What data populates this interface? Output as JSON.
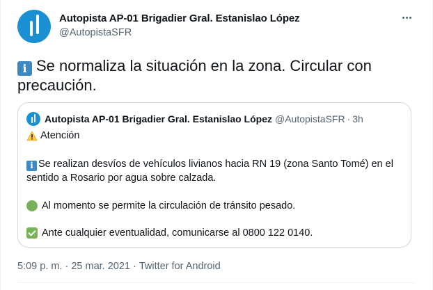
{
  "author": {
    "display_name": "Autopista AP-01 Brigadier Gral. Estanislao López",
    "handle": "@AutopistaSFR"
  },
  "tweet": {
    "info_symbol": "i",
    "text": "Se normaliza la situación en la zona. Circular con precaución."
  },
  "quoted": {
    "display_name": "Autopista AP-01 Brigadier Gral. Estanislao López",
    "handle": "@AutopistaSFR",
    "separator": "·",
    "time": "3h",
    "warning": "Atención",
    "info_symbol": "i",
    "paragraph": "Se realizan desvíos de vehículos livianos hacia RN 19 (zona Santo Tomé) en el sentido a Rosario por agua sobre calzada.",
    "line_green": "Al momento se permite la circulación de tránsito pesado.",
    "line_check": "Ante cualquier eventualidad, comunicarse al 0800 122 0140."
  },
  "meta": {
    "time": "5:09 p. m.",
    "separator": "·",
    "date": "25 mar. 2021",
    "source": "Twitter for Android"
  },
  "colors": {
    "brand": "#1a8fd2",
    "secondary_text": "#536471",
    "info_emoji": "#3b88c3"
  },
  "icons": {
    "more": "more-dots-icon",
    "info": "information-icon",
    "warning": "warning-icon",
    "green": "green-circle-icon",
    "check": "check-mark-icon"
  }
}
